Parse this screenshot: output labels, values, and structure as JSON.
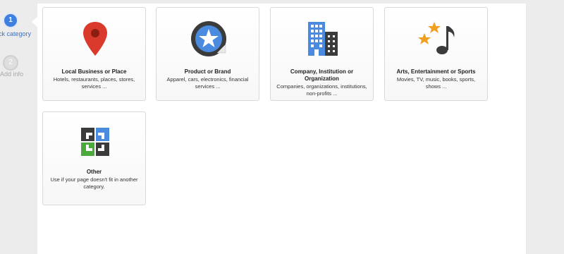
{
  "stepper": {
    "steps": [
      {
        "number": "1",
        "label": "ck category"
      },
      {
        "number": "2",
        "label": "Add info"
      }
    ]
  },
  "categories": [
    {
      "title": "Local Business or Place",
      "description": "Hotels, restaurants, places, stores, services ...",
      "icon": "map-pin-icon"
    },
    {
      "title": "Product or Brand",
      "description": "Apparel, cars, electronics, financial services ...",
      "icon": "star-sticker-icon"
    },
    {
      "title": "Company, Institution or Organization",
      "description": "Companies, organizations, institutions, non-profits ...",
      "icon": "buildings-icon"
    },
    {
      "title": "Arts, Entertainment or Sports",
      "description": "Movies, TV, music, books, sports, shows ...",
      "icon": "music-stars-icon"
    },
    {
      "title": "Other",
      "description": "Use if your page doesn't fit in another category.",
      "icon": "puzzle-arrows-icon"
    }
  ],
  "colors": {
    "accent_blue": "#3f7fe0",
    "pin_red": "#d93a2b",
    "building_blue": "#4a8be0",
    "star_orange": "#f0a020",
    "green": "#4caa3c"
  }
}
